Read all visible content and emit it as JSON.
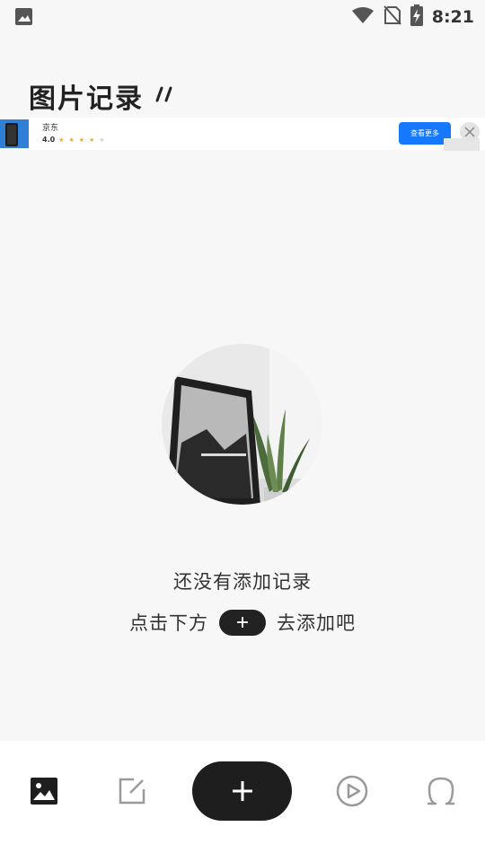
{
  "status_bar": {
    "time": "8:21",
    "icons": [
      "image-notification-icon",
      "wifi-icon",
      "no-sim-icon",
      "battery-charging-icon"
    ]
  },
  "header": {
    "title": "图片记录"
  },
  "ad": {
    "app_name": "京东",
    "rating": "4.0",
    "stars_filled": 4,
    "stars_total": 5,
    "cta_label": "查看更多"
  },
  "empty_state": {
    "title": "还没有添加记录",
    "hint_before": "点击下方",
    "hint_after": "去添加吧"
  },
  "bottom_nav": {
    "items": [
      "gallery-icon",
      "edit-icon",
      "add-icon",
      "play-icon",
      "profile-icon"
    ],
    "active_index": 0
  },
  "colors": {
    "background": "#f7f7f7",
    "accent_dark": "#1e1e1e",
    "cta_blue": "#1677ff",
    "star": "#f5a623",
    "inactive_icon": "#9a9a9a"
  }
}
